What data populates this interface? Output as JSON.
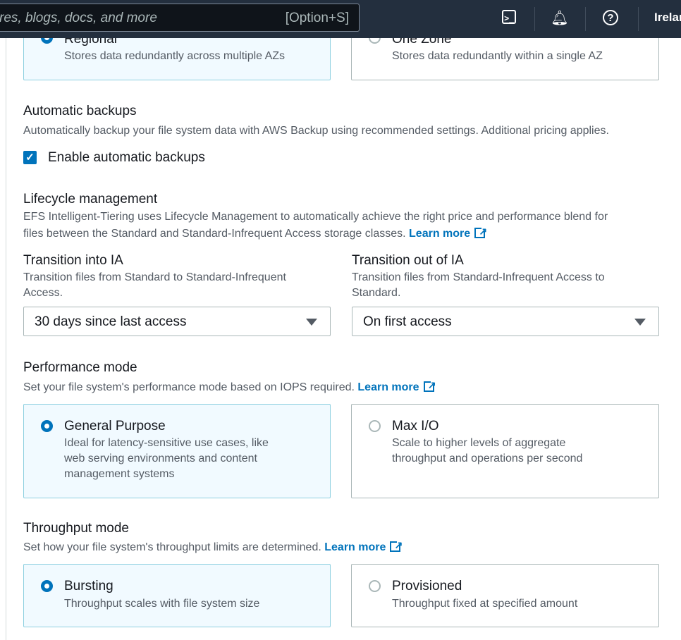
{
  "header": {
    "search_placeholder": "res, blogs, docs, and more",
    "search_shortcut": "[Option+S]",
    "region": "Irelan",
    "icons": [
      "cloudshell-icon",
      "bell-icon",
      "help-icon"
    ]
  },
  "availability": {
    "options": [
      {
        "label": "Regional",
        "description": "Stores data redundantly across multiple AZs",
        "selected": true
      },
      {
        "label": "One Zone",
        "description": "Stores data redundantly within a single AZ",
        "selected": false
      }
    ]
  },
  "backups": {
    "title": "Automatic backups",
    "description": "Automatically backup your file system data with AWS Backup using recommended settings. Additional pricing applies.",
    "checkbox_label": "Enable automatic backups",
    "checked": true
  },
  "lifecycle": {
    "title": "Lifecycle management",
    "description_line1": "EFS Intelligent-Tiering uses Lifecycle Management to automatically achieve the right price and performance blend for",
    "description_line2": "files between the Standard and Standard-Infrequent Access storage classes.",
    "learn_more": "Learn more",
    "into_ia": {
      "title": "Transition into IA",
      "desc1": "Transition files from Standard to Standard-Infrequent",
      "desc2": "Access.",
      "value": "30 days since last access"
    },
    "out_of_ia": {
      "title": "Transition out of IA",
      "desc1": "Transition files from Standard-Infrequent Access to",
      "desc2": "Standard.",
      "value": "On first access"
    }
  },
  "performance": {
    "title": "Performance mode",
    "description": "Set your file system's performance mode based on IOPS required.",
    "learn_more": "Learn more",
    "options": [
      {
        "label": "General Purpose",
        "desc": [
          "Ideal for latency-sensitive use cases, like",
          "web serving environments and content",
          "management systems"
        ],
        "selected": true
      },
      {
        "label": "Max I/O",
        "desc": [
          "Scale to higher levels of aggregate",
          "throughput and operations per second"
        ],
        "selected": false
      }
    ]
  },
  "throughput": {
    "title": "Throughput mode",
    "description": "Set how your file system's throughput limits are determined.",
    "learn_more": "Learn more",
    "options": [
      {
        "label": "Bursting",
        "desc": "Throughput scales with file system size",
        "selected": true
      },
      {
        "label": "Provisioned",
        "desc": "Throughput fixed at specified amount",
        "selected": false
      }
    ]
  },
  "colors": {
    "accent": "#0073bb",
    "header_bg": "#232f3e",
    "selected_bg": "#f1faff"
  }
}
